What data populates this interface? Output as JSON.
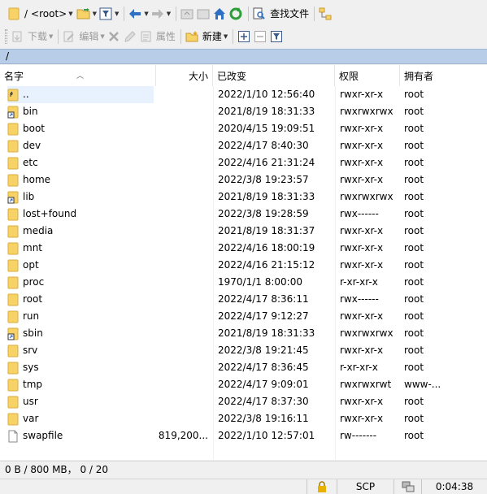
{
  "toolbar1": {
    "path_label": "/",
    "path_value": "<root>",
    "find_files_label": "查找文件"
  },
  "toolbar2": {
    "download_label": "下载",
    "edit_label": "编辑",
    "properties_label": "属性",
    "new_label": "新建"
  },
  "current_path": "/",
  "columns": {
    "name": "名字",
    "size": "大小",
    "changed": "已改变",
    "rights": "权限",
    "owner": "拥有者"
  },
  "files": [
    {
      "name": "..",
      "size": "",
      "changed": "2022/1/10 12:56:40",
      "rights": "rwxr-xr-x",
      "owner": "root",
      "icon": "parent-dir-icon"
    },
    {
      "name": "bin",
      "size": "",
      "changed": "2021/8/19 18:31:33",
      "rights": "rwxrwxrwx",
      "owner": "root",
      "icon": "symlink-folder-icon"
    },
    {
      "name": "boot",
      "size": "",
      "changed": "2020/4/15 19:09:51",
      "rights": "rwxr-xr-x",
      "owner": "root",
      "icon": "folder-icon"
    },
    {
      "name": "dev",
      "size": "",
      "changed": "2022/4/17 8:40:30",
      "rights": "rwxr-xr-x",
      "owner": "root",
      "icon": "folder-icon"
    },
    {
      "name": "etc",
      "size": "",
      "changed": "2022/4/16 21:31:24",
      "rights": "rwxr-xr-x",
      "owner": "root",
      "icon": "folder-icon"
    },
    {
      "name": "home",
      "size": "",
      "changed": "2022/3/8 19:23:57",
      "rights": "rwxr-xr-x",
      "owner": "root",
      "icon": "folder-icon"
    },
    {
      "name": "lib",
      "size": "",
      "changed": "2021/8/19 18:31:33",
      "rights": "rwxrwxrwx",
      "owner": "root",
      "icon": "symlink-folder-icon"
    },
    {
      "name": "lost+found",
      "size": "",
      "changed": "2022/3/8 19:28:59",
      "rights": "rwx------",
      "owner": "root",
      "icon": "folder-icon"
    },
    {
      "name": "media",
      "size": "",
      "changed": "2021/8/19 18:31:37",
      "rights": "rwxr-xr-x",
      "owner": "root",
      "icon": "folder-icon"
    },
    {
      "name": "mnt",
      "size": "",
      "changed": "2022/4/16 18:00:19",
      "rights": "rwxr-xr-x",
      "owner": "root",
      "icon": "folder-icon"
    },
    {
      "name": "opt",
      "size": "",
      "changed": "2022/4/16 21:15:12",
      "rights": "rwxr-xr-x",
      "owner": "root",
      "icon": "folder-icon"
    },
    {
      "name": "proc",
      "size": "",
      "changed": "1970/1/1 8:00:00",
      "rights": "r-xr-xr-x",
      "owner": "root",
      "icon": "folder-icon"
    },
    {
      "name": "root",
      "size": "",
      "changed": "2022/4/17 8:36:11",
      "rights": "rwx------",
      "owner": "root",
      "icon": "folder-icon"
    },
    {
      "name": "run",
      "size": "",
      "changed": "2022/4/17 9:12:27",
      "rights": "rwxr-xr-x",
      "owner": "root",
      "icon": "folder-icon"
    },
    {
      "name": "sbin",
      "size": "",
      "changed": "2021/8/19 18:31:33",
      "rights": "rwxrwxrwx",
      "owner": "root",
      "icon": "symlink-folder-icon"
    },
    {
      "name": "srv",
      "size": "",
      "changed": "2022/3/8 19:21:45",
      "rights": "rwxr-xr-x",
      "owner": "root",
      "icon": "folder-icon"
    },
    {
      "name": "sys",
      "size": "",
      "changed": "2022/4/17 8:36:45",
      "rights": "r-xr-xr-x",
      "owner": "root",
      "icon": "folder-icon"
    },
    {
      "name": "tmp",
      "size": "",
      "changed": "2022/4/17 9:09:01",
      "rights": "rwxrwxrwt",
      "owner": "www-...",
      "icon": "folder-icon"
    },
    {
      "name": "usr",
      "size": "",
      "changed": "2022/4/17 8:37:30",
      "rights": "rwxr-xr-x",
      "owner": "root",
      "icon": "folder-icon"
    },
    {
      "name": "var",
      "size": "",
      "changed": "2022/3/8 19:16:11",
      "rights": "rwxr-xr-x",
      "owner": "root",
      "icon": "folder-icon"
    },
    {
      "name": "swapfile",
      "size": "819,200...",
      "changed": "2022/1/10 12:57:01",
      "rights": "rw-------",
      "owner": "root",
      "icon": "file-icon"
    }
  ],
  "status": {
    "summary": "0 B / 800 MB， 0 / 20"
  },
  "bottom_bar": {
    "protocol": "SCP",
    "session_time": "0:04:38"
  },
  "colors": {
    "folder": "#f7d267",
    "path_bar": "#b7cde8",
    "selection": "#e8f2ff"
  }
}
